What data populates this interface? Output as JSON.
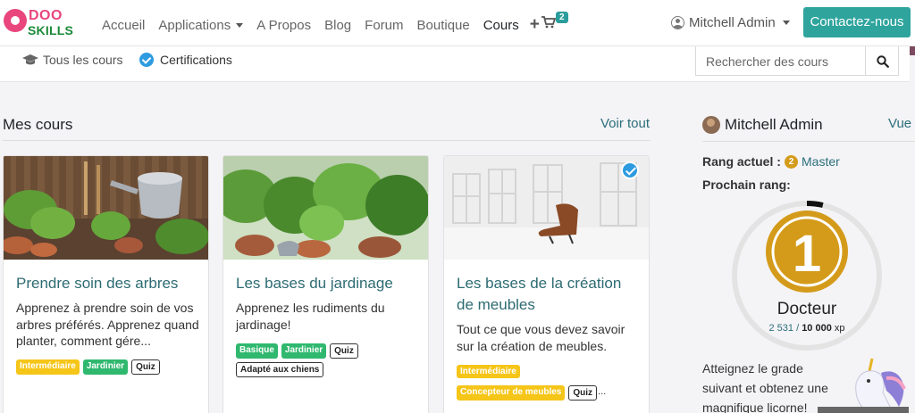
{
  "navbar": {
    "logo_top": "DOO",
    "logo_bottom": "SKILLS",
    "items": [
      "Accueil",
      "Applications",
      "A Propos",
      "Blog",
      "Forum",
      "Boutique",
      "Cours"
    ],
    "cart_count": "2",
    "user": "Mitchell Admin",
    "contact_label": "Contactez-nous"
  },
  "subnav": {
    "all_courses": "Tous les cours",
    "certifications": "Certifications",
    "search_placeholder": "Rechercher des cours"
  },
  "main": {
    "section_title": "Mes cours",
    "see_all": "Voir tout",
    "courses": [
      {
        "title": "Prendre soin des arbres",
        "desc": "Apprenez à prendre soin de vos arbres préférés. Apprenez quand planter, comment gére...",
        "tags": [
          {
            "label": "Intermédiaire",
            "style": "yellow"
          },
          {
            "label": "Jardinier",
            "style": "green"
          },
          {
            "label": "Quiz",
            "style": "outline"
          }
        ]
      },
      {
        "title": "Les bases du jardinage",
        "desc": "Apprenez les rudiments du jardinage!",
        "tags": [
          {
            "label": "Basique",
            "style": "green"
          },
          {
            "label": "Jardinier",
            "style": "green"
          },
          {
            "label": "Quiz",
            "style": "outline"
          },
          {
            "label": "Adapté aux chiens",
            "style": "outline"
          }
        ]
      },
      {
        "title": "Les bases de la création de meubles",
        "desc": "Tout ce que vous devez savoir sur la création de meubles.",
        "tags": [
          {
            "label": "Intermédiaire",
            "style": "yellow"
          },
          {
            "label": "Concepteur de meubles",
            "style": "yellow"
          },
          {
            "label": "Quiz",
            "style": "outline"
          }
        ],
        "more": "..."
      }
    ]
  },
  "sidebar": {
    "user_name": "Mitchell Admin",
    "view_label": "Vue",
    "current_rank_label": "Rang actuel :",
    "current_rank": "Master",
    "current_rank_number": "2",
    "next_rank_label": "Prochain rang:",
    "next_rank_number": "1",
    "next_rank": "Docteur",
    "xp_current": "2 531",
    "xp_sep": "/",
    "xp_target": "10 000",
    "xp_unit": "xp",
    "xp_progress": 0.2531,
    "promo": "Atteignez le grade suivant et obtenez une magnifique licorne!"
  },
  "colors": {
    "accent": "#2ea49d",
    "link": "#2a6f7a",
    "medal_gold": "#d49b1a",
    "cert_blue": "#2c9be0"
  }
}
